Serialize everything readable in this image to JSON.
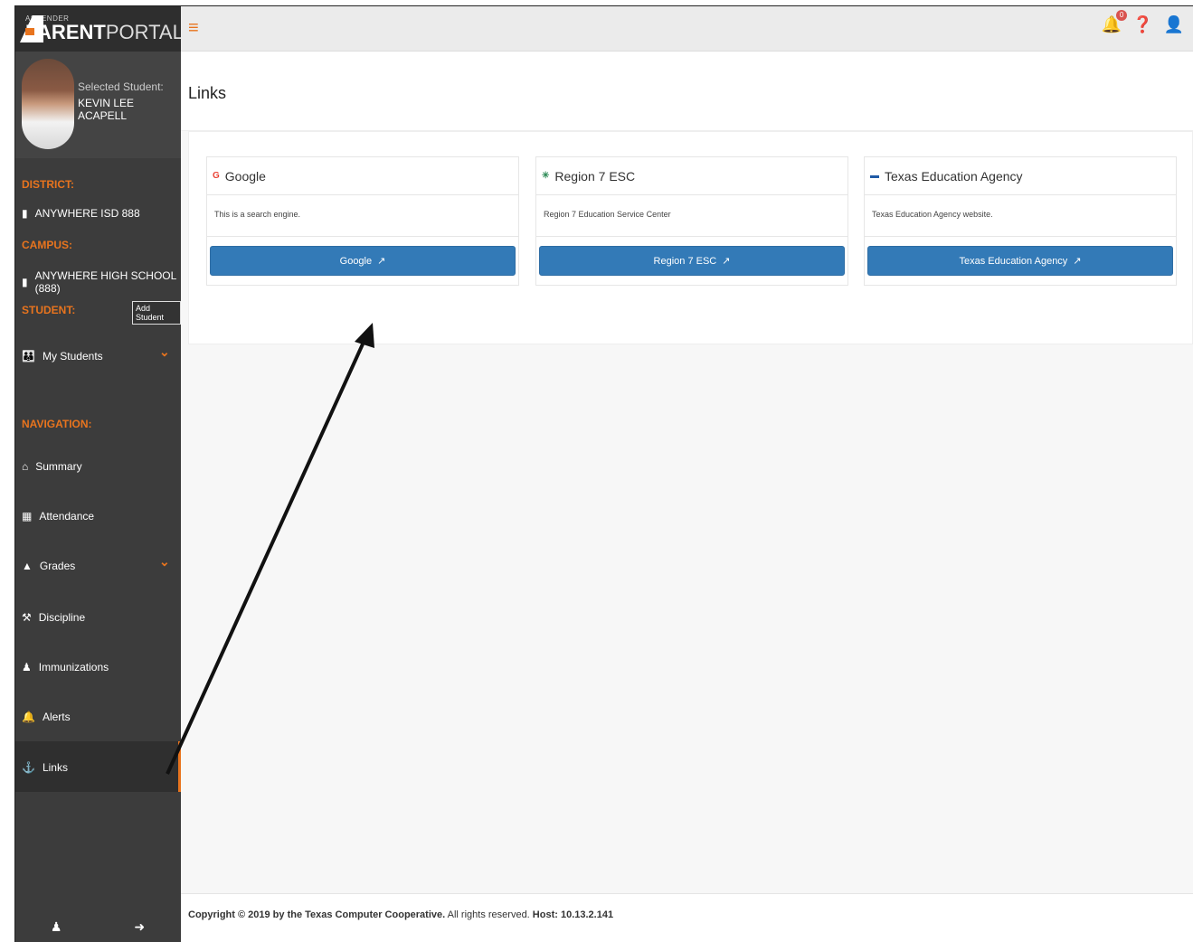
{
  "brand": {
    "small": "ASCENDER",
    "bold": "PARENT",
    "light": "PORTAL"
  },
  "student": {
    "selected_label": "Selected Student:",
    "name": "KEVIN LEE ACAPELL"
  },
  "sidebar": {
    "district_label": "DISTRICT:",
    "district_value": "ANYWHERE ISD 888",
    "campus_label": "CAMPUS:",
    "campus_value": "ANYWHERE HIGH SCHOOL (888)",
    "student_label": "STUDENT:",
    "add_student": "Add Student",
    "my_students": "My Students",
    "navigation_label": "NAVIGATION:",
    "nav": [
      {
        "label": "Summary",
        "icon": "home-icon"
      },
      {
        "label": "Attendance",
        "icon": "calendar-icon"
      },
      {
        "label": "Grades",
        "icon": "graduation-cap-icon"
      },
      {
        "label": "Discipline",
        "icon": "gavel-icon"
      },
      {
        "label": "Immunizations",
        "icon": "user-md-icon"
      },
      {
        "label": "Alerts",
        "icon": "bell-icon"
      },
      {
        "label": "Links",
        "icon": "anchor-icon"
      }
    ]
  },
  "topbar": {
    "notification_count": "0"
  },
  "page": {
    "title": "Links"
  },
  "cards": [
    {
      "title": "Google",
      "description": "This is a search engine.",
      "button": "Google"
    },
    {
      "title": "Region 7 ESC",
      "description": "Region 7 Education Service Center",
      "button": "Region 7 ESC"
    },
    {
      "title": "Texas Education Agency",
      "description": "Texas Education Agency website.",
      "button": "Texas Education Agency"
    }
  ],
  "footer": {
    "copyright": "Copyright © 2019 by the Texas Computer Cooperative.",
    "rights": " All rights reserved. ",
    "host": "Host: 10.13.2.141"
  },
  "colors": {
    "accent": "#e8741e",
    "sidebar": "#3c3c3c",
    "button": "#337ab7"
  }
}
